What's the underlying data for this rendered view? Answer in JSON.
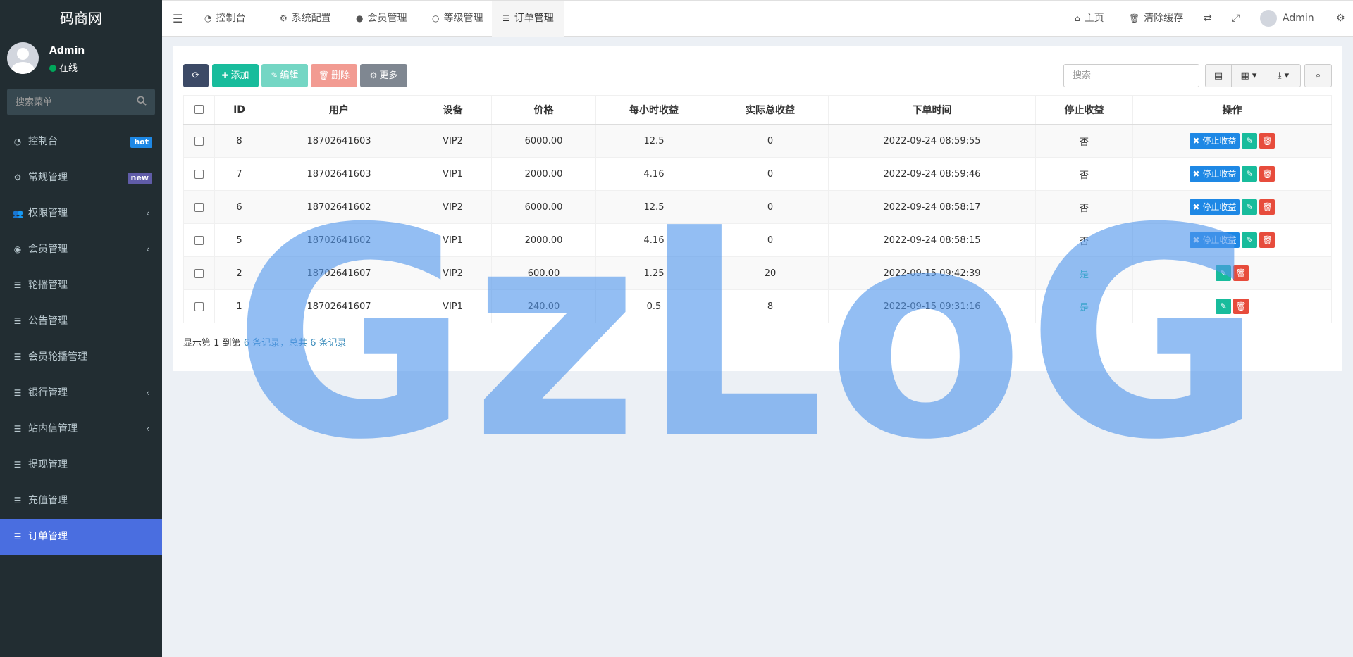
{
  "app": {
    "logo": "码商网"
  },
  "user": {
    "name": "Admin",
    "status": "在线"
  },
  "sidebar": {
    "search_placeholder": "搜索菜单",
    "items": [
      {
        "label": "控制台",
        "icon": "dashboard-icon",
        "badge": "hot"
      },
      {
        "label": "常规管理",
        "icon": "cogs-icon",
        "badge": "new"
      },
      {
        "label": "权限管理",
        "icon": "group-icon",
        "chevron": "‹"
      },
      {
        "label": "会员管理",
        "icon": "user-circle-icon",
        "chevron": "‹"
      },
      {
        "label": "轮播管理",
        "icon": "list-icon"
      },
      {
        "label": "公告管理",
        "icon": "list-icon"
      },
      {
        "label": "会员轮播管理",
        "icon": "list-icon"
      },
      {
        "label": "银行管理",
        "icon": "list-icon",
        "chevron": "‹"
      },
      {
        "label": "站内信管理",
        "icon": "list-icon",
        "chevron": "‹"
      },
      {
        "label": "提现管理",
        "icon": "list-icon"
      },
      {
        "label": "充值管理",
        "icon": "list-icon"
      },
      {
        "label": "订单管理",
        "icon": "list-icon",
        "active": true
      }
    ]
  },
  "topnav": {
    "tabs": [
      {
        "label": "控制台",
        "icon": "dashboard-icon"
      },
      {
        "label": "系统配置",
        "icon": "cog-icon"
      },
      {
        "label": "会员管理",
        "icon": "user-icon"
      },
      {
        "label": "等级管理",
        "icon": "circle-icon"
      },
      {
        "label": "订单管理",
        "icon": "list-icon",
        "active": true
      }
    ],
    "right": {
      "home": "主页",
      "clear_cache": "清除缓存",
      "admin": "Admin"
    }
  },
  "toolbar": {
    "add": "添加",
    "edit": "编辑",
    "delete": "删除",
    "more": "更多",
    "search_placeholder": "搜索"
  },
  "table": {
    "columns": [
      "ID",
      "用户",
      "设备",
      "价格",
      "每小时收益",
      "实际总收益",
      "下单时间",
      "停止收益",
      "操作"
    ],
    "stop_label": "停止收益",
    "rows": [
      {
        "id": "8",
        "user": "18702641603",
        "device": "VIP2",
        "price": "6000.00",
        "hourly": "12.5",
        "total": "0",
        "time": "2022-09-24 08:59:55",
        "stopped": "否",
        "can_stop": true
      },
      {
        "id": "7",
        "user": "18702641603",
        "device": "VIP1",
        "price": "2000.00",
        "hourly": "4.16",
        "total": "0",
        "time": "2022-09-24 08:59:46",
        "stopped": "否",
        "can_stop": true
      },
      {
        "id": "6",
        "user": "18702641602",
        "device": "VIP2",
        "price": "6000.00",
        "hourly": "12.5",
        "total": "0",
        "time": "2022-09-24 08:58:17",
        "stopped": "否",
        "can_stop": true
      },
      {
        "id": "5",
        "user": "18702641602",
        "device": "VIP1",
        "price": "2000.00",
        "hourly": "4.16",
        "total": "0",
        "time": "2022-09-24 08:58:15",
        "stopped": "否",
        "can_stop": true
      },
      {
        "id": "2",
        "user": "18702641607",
        "device": "VIP2",
        "price": "600.00",
        "hourly": "1.25",
        "total": "20",
        "time": "2022-09-15 09:42:39",
        "stopped": "是",
        "can_stop": false
      },
      {
        "id": "1",
        "user": "18702641607",
        "device": "VIP1",
        "price": "240.00",
        "hourly": "0.5",
        "total": "8",
        "time": "2022-09-15 09:31:16",
        "stopped": "是",
        "can_stop": false
      }
    ]
  },
  "pager": {
    "text1": "显示第 1 到第",
    "num1": "6 条记录，总共",
    "num2": "6",
    "text2": "条记录"
  },
  "watermark": "GzLoG",
  "colors": {
    "sidebar_bg": "#222d32",
    "active": "#4a6ee0",
    "primary": "#1e88e5",
    "success": "#18bc9c",
    "danger": "#e74c3c"
  }
}
